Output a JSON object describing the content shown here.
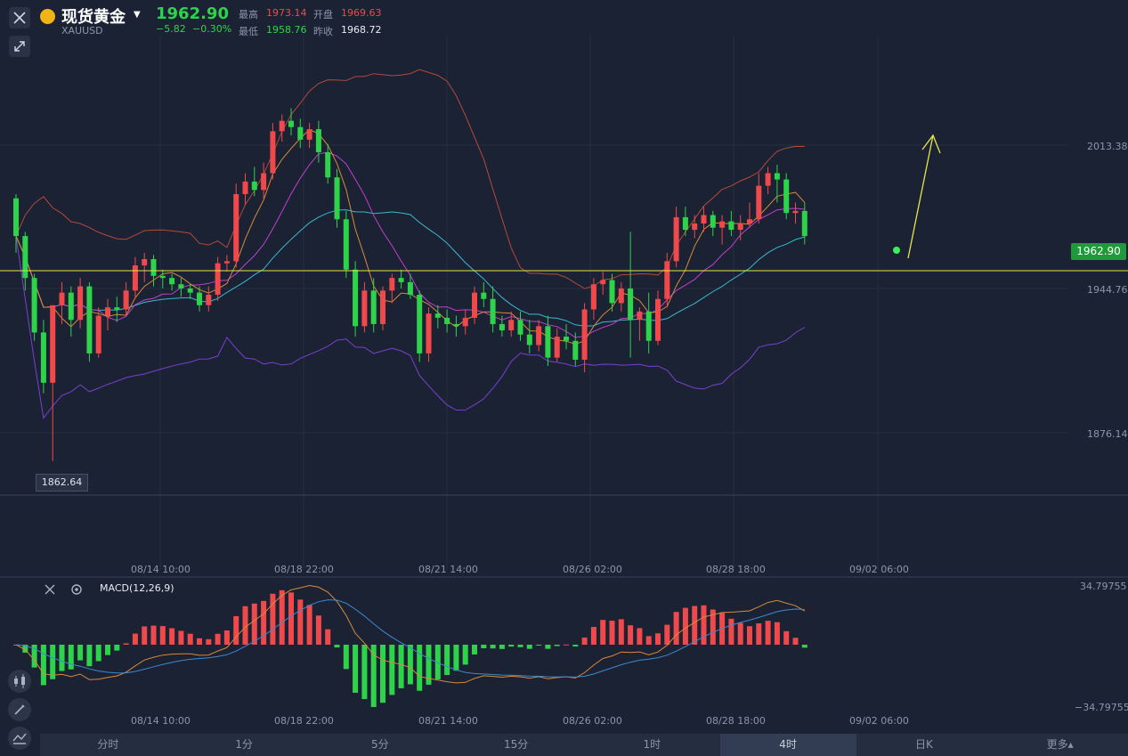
{
  "header": {
    "symbol_name": "现货黄金",
    "symbol_code": "XAUUSD",
    "price": "1962.90",
    "change": "−5.82",
    "change_pct": "−0.30%",
    "high_label": "最高",
    "high_value": "1973.14",
    "open_label": "开盘",
    "open_value": "1969.63",
    "low_label": "最低",
    "low_value": "1958.76",
    "prev_close_label": "昨收",
    "prev_close_value": "1968.72"
  },
  "colors": {
    "up": "#f0494b",
    "down": "#2dd44a",
    "background": "#1b2233",
    "last_price_line": "#e6e64a"
  },
  "icons": {
    "close": "close-icon",
    "expand": "expand-arrows-icon",
    "settings": "gear-icon",
    "candle_tool": "candlestick-icon",
    "draw_tool": "pencil-icon",
    "indicator_tool": "indicator-icon"
  },
  "price_axis": [
    "2013.38",
    "1944.76",
    "1876.14"
  ],
  "last_price_tag": "1962.90",
  "low_marker": "1862.64",
  "time_axis": [
    "08/14 10:00",
    "08/18 22:00",
    "08/21 14:00",
    "08/26 02:00",
    "08/28 18:00",
    "09/02 06:00"
  ],
  "macd": {
    "label": "MACD(12,26,9)",
    "axis_top": "34.79755",
    "axis_bottom": "−34.79755"
  },
  "tabs": [
    "分时",
    "1分",
    "5分",
    "15分",
    "1时",
    "4时",
    "日K",
    "更多▴"
  ],
  "active_tab": "4时",
  "chart_data": {
    "type": "candlestick",
    "timeframe": "4时",
    "ylim": [
      1862.64,
      2032
    ],
    "x_ticks": [
      "08/14 10:00",
      "08/18 22:00",
      "08/21 14:00",
      "08/26 02:00",
      "08/28 18:00",
      "09/02 06:00"
    ],
    "y_ticks": [
      2013.38,
      1944.76,
      1876.14
    ],
    "candles": [
      [
        1988,
        1990,
        1962,
        1970
      ],
      [
        1970,
        1972,
        1944,
        1950
      ],
      [
        1950,
        1952,
        1920,
        1924
      ],
      [
        1924,
        1930,
        1895,
        1900
      ],
      [
        1900,
        1930,
        1862.64,
        1937
      ],
      [
        1937,
        1948,
        1928,
        1943
      ],
      [
        1943,
        1946,
        1922,
        1930
      ],
      [
        1930,
        1950,
        1926,
        1946
      ],
      [
        1946,
        1948,
        1910,
        1914
      ],
      [
        1914,
        1936,
        1912,
        1932
      ],
      [
        1932,
        1940,
        1925,
        1936
      ],
      [
        1936,
        1941,
        1929,
        1935
      ],
      [
        1935,
        1948,
        1932,
        1944
      ],
      [
        1944,
        1960,
        1940,
        1956
      ],
      [
        1956,
        1962,
        1948,
        1959
      ],
      [
        1959,
        1961,
        1946,
        1951
      ],
      [
        1951,
        1954,
        1945,
        1950
      ],
      [
        1950,
        1952,
        1944,
        1947
      ],
      [
        1947,
        1950,
        1941,
        1945
      ],
      [
        1945,
        1947,
        1940,
        1943
      ],
      [
        1943,
        1946,
        1934,
        1937
      ],
      [
        1937,
        1946,
        1934,
        1942
      ],
      [
        1942,
        1960,
        1939,
        1957
      ],
      [
        1957,
        1961,
        1953,
        1958
      ],
      [
        1958,
        1995,
        1955,
        1990
      ],
      [
        1990,
        2000,
        1985,
        1996
      ],
      [
        1996,
        2003,
        1989,
        1992
      ],
      [
        1992,
        2005,
        1988,
        2000
      ],
      [
        2000,
        2024,
        1997,
        2020
      ],
      [
        2020,
        2028,
        2015,
        2025
      ],
      [
        2025,
        2031,
        2018,
        2022
      ],
      [
        2022,
        2026,
        2012,
        2016
      ],
      [
        2016,
        2024,
        2012,
        2021
      ],
      [
        2021,
        2025,
        2005,
        2010
      ],
      [
        2010,
        2014,
        1995,
        1998
      ],
      [
        1998,
        2002,
        1974,
        1978
      ],
      [
        1978,
        1982,
        1950,
        1954
      ],
      [
        1954,
        1958,
        1922,
        1927
      ],
      [
        1927,
        1948,
        1924,
        1944
      ],
      [
        1944,
        1950,
        1924,
        1928
      ],
      [
        1928,
        1946,
        1925,
        1944
      ],
      [
        1944,
        1952,
        1938,
        1950
      ],
      [
        1950,
        1954,
        1945,
        1948
      ],
      [
        1948,
        1952,
        1940,
        1942
      ],
      [
        1942,
        1944,
        1910,
        1914
      ],
      [
        1914,
        1936,
        1910,
        1933
      ],
      [
        1933,
        1937,
        1926,
        1931
      ],
      [
        1931,
        1935,
        1924,
        1928
      ],
      [
        1928,
        1932,
        1922,
        1927
      ],
      [
        1927,
        1935,
        1923,
        1931
      ],
      [
        1931,
        1946,
        1928,
        1943
      ],
      [
        1943,
        1948,
        1936,
        1940
      ],
      [
        1940,
        1946,
        1924,
        1928
      ],
      [
        1928,
        1932,
        1922,
        1925
      ],
      [
        1925,
        1934,
        1922,
        1930
      ],
      [
        1930,
        1934,
        1920,
        1923
      ],
      [
        1923,
        1930,
        1914,
        1918
      ],
      [
        1918,
        1930,
        1915,
        1927
      ],
      [
        1927,
        1932,
        1908,
        1912
      ],
      [
        1912,
        1926,
        1910,
        1922
      ],
      [
        1922,
        1928,
        1916,
        1920
      ],
      [
        1920,
        1924,
        1908,
        1911
      ],
      [
        1911,
        1938,
        1905,
        1935
      ],
      [
        1935,
        1950,
        1930,
        1947
      ],
      [
        1947,
        1953,
        1942,
        1949
      ],
      [
        1949,
        1952,
        1934,
        1938
      ],
      [
        1938,
        1948,
        1934,
        1945
      ],
      [
        1945,
        1972,
        1912,
        1930
      ],
      [
        1930,
        1936,
        1920,
        1934
      ],
      [
        1934,
        1943,
        1914,
        1920
      ],
      [
        1920,
        1944,
        1918,
        1940
      ],
      [
        1940,
        1962,
        1936,
        1958
      ],
      [
        1958,
        1984,
        1955,
        1979
      ],
      [
        1979,
        1984,
        1970,
        1973
      ],
      [
        1973,
        1980,
        1969,
        1976
      ],
      [
        1976,
        1984,
        1972,
        1980
      ],
      [
        1980,
        1982,
        1970,
        1974
      ],
      [
        1974,
        1980,
        1966,
        1977
      ],
      [
        1977,
        1982,
        1970,
        1973
      ],
      [
        1973,
        1980,
        1968,
        1976
      ],
      [
        1976,
        1986,
        1974,
        1978
      ],
      [
        1978,
        2000,
        1976,
        1994
      ],
      [
        1994,
        2003,
        1990,
        2000
      ],
      [
        2000,
        2004,
        1986,
        1997
      ],
      [
        1997,
        2000,
        1978,
        1981
      ],
      [
        1981,
        1986,
        1976,
        1982
      ],
      [
        1982,
        1986,
        1966,
        1970
      ]
    ]
  }
}
